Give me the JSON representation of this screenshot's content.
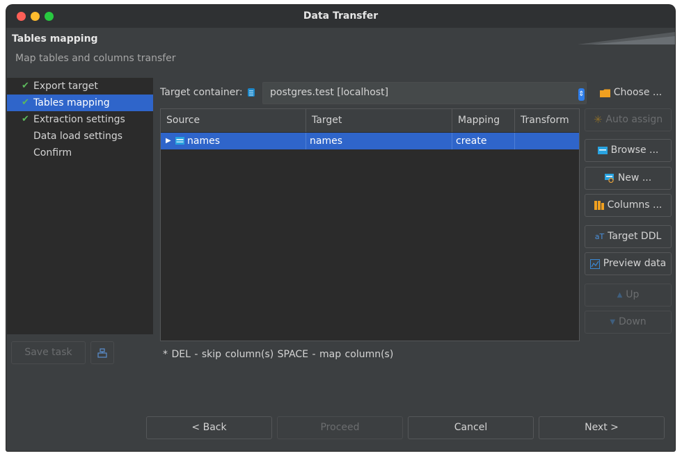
{
  "window": {
    "title": "Data Transfer"
  },
  "header": {
    "title": "Tables mapping",
    "subtitle": "Map tables and columns transfer"
  },
  "sidebar": {
    "items": [
      {
        "label": "Export target",
        "done": true
      },
      {
        "label": "Tables mapping",
        "done": true,
        "selected": true
      },
      {
        "label": "Extraction settings",
        "done": true
      },
      {
        "label": "Data load settings",
        "done": false
      },
      {
        "label": "Confirm",
        "done": false
      }
    ],
    "save_task_label": "Save task"
  },
  "target": {
    "label": "Target container:",
    "value": "postgres.test  [localhost]",
    "choose_label": "Choose ..."
  },
  "table": {
    "columns": [
      "Source",
      "Target",
      "Mapping",
      "Transform"
    ],
    "rows": [
      {
        "source": "names",
        "target": "names",
        "mapping": "create",
        "transform": ""
      }
    ]
  },
  "actions": {
    "auto_assign": "Auto assign",
    "browse": "Browse ...",
    "new": "New ...",
    "columns": "Columns ...",
    "target_ddl": "Target DDL",
    "preview_data": "Preview data",
    "up": "Up",
    "down": "Down"
  },
  "hint": "* DEL - skip column(s)  SPACE - map column(s)",
  "footer": {
    "back": "< Back",
    "proceed": "Proceed",
    "cancel": "Cancel",
    "next": "Next >"
  },
  "colors": {
    "selection": "#2f65ca",
    "background": "#3c3f41",
    "panel": "#2b2b2b",
    "check": "#5cb85c"
  }
}
